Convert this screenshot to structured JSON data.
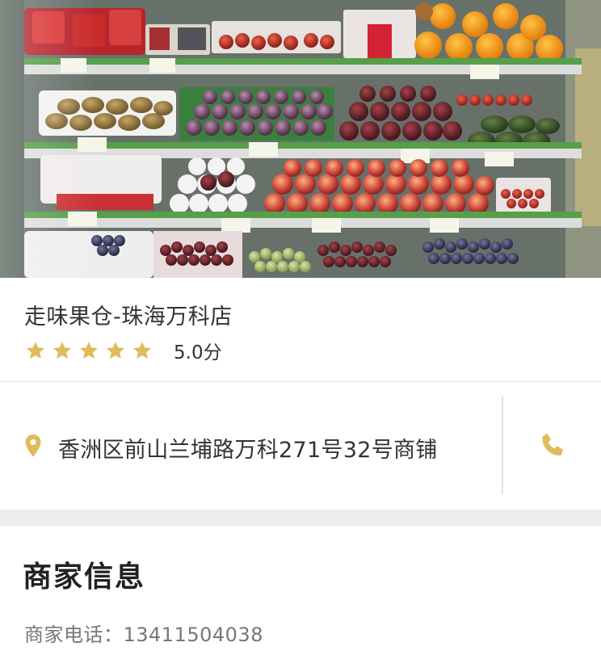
{
  "shop": {
    "name": "走味果仓-珠海万科店",
    "rating_stars": 5,
    "score_text": "5.0分"
  },
  "address": {
    "text": "香洲区前山兰埔路万科271号32号商铺",
    "pin_icon": "location-pin-icon",
    "call_icon": "phone-icon"
  },
  "merchant_info": {
    "title": "商家信息",
    "phone_label": "商家电话：",
    "phone_number": "13411504038"
  },
  "colors": {
    "accent": "#e0bb5c",
    "text": "#333333",
    "muted": "#777777",
    "divider": "#e4e4e4",
    "gap": "#ececec"
  }
}
